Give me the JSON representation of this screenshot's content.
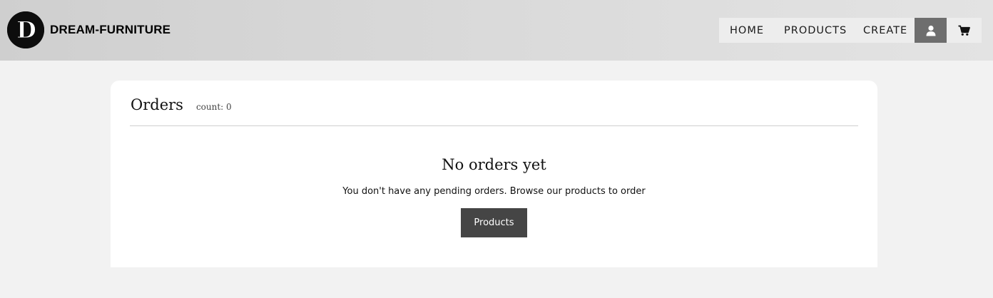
{
  "header": {
    "brand_name": "DREAM-FURNITURE",
    "logo_letter": "D",
    "nav": {
      "home": "HOME",
      "products": "PRODUCTS",
      "create": "CREATE",
      "user_icon": "user-icon",
      "cart_icon": "cart-icon"
    }
  },
  "orders": {
    "title": "Orders",
    "count_label": "count: 0",
    "empty_title": "No orders yet",
    "empty_message": "You don't have any pending orders. Browse our products to order",
    "products_button": "Products"
  },
  "colors": {
    "button_bg": "#454545",
    "nav_active_bg": "#6e6e6e",
    "page_bg": "#f2f2f2"
  }
}
